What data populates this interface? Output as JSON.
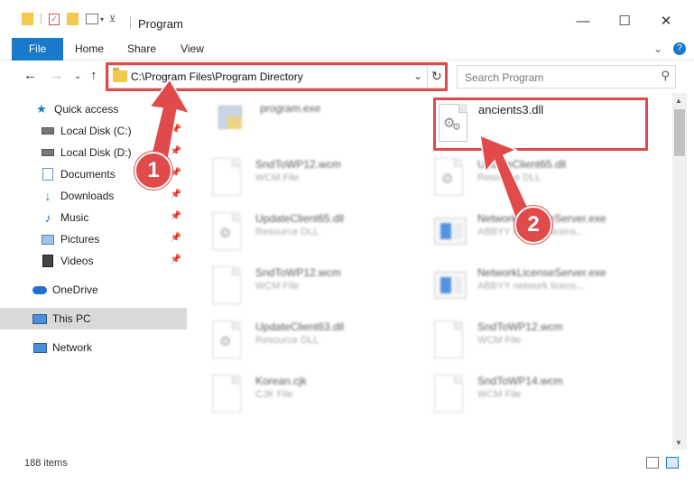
{
  "window": {
    "title": "Program",
    "minimize": "—",
    "maximize": "☐",
    "close": "✕"
  },
  "ribbon": {
    "tabs": [
      "File",
      "Home",
      "Share",
      "View"
    ],
    "collapse": "⌄",
    "help": "?"
  },
  "nav": {
    "back": "←",
    "forward": "→",
    "recent": "⌄",
    "up": "↑",
    "address": "C:\\Program Files\\Program Directory",
    "address_dropdown": "⌄",
    "refresh": "↻",
    "search_placeholder": "Search Program",
    "search_icon": "⚲"
  },
  "sidebar": {
    "items": [
      {
        "label": "Quick access",
        "icon": "star-icon"
      },
      {
        "label": "Local Disk (C:)",
        "icon": "drive-icon",
        "pinned": true
      },
      {
        "label": "Local Disk (D:)",
        "icon": "drive-icon",
        "pinned": true
      },
      {
        "label": "Documents",
        "icon": "documents-icon",
        "pinned": true
      },
      {
        "label": "Downloads",
        "icon": "downloads-icon",
        "pinned": true
      },
      {
        "label": "Music",
        "icon": "music-icon",
        "pinned": true
      },
      {
        "label": "Pictures",
        "icon": "pictures-icon",
        "pinned": true
      },
      {
        "label": "Videos",
        "icon": "videos-icon",
        "pinned": true
      },
      {
        "label": "OneDrive",
        "icon": "cloud-icon"
      },
      {
        "label": "This PC",
        "icon": "computer-icon",
        "selected": true
      },
      {
        "label": "Network",
        "icon": "network-icon"
      }
    ]
  },
  "files": [
    {
      "name": "program.exe",
      "type": ""
    },
    {
      "name": "ancients3.dll",
      "type": ""
    },
    {
      "name": "SndToWP12.wcm",
      "type": "WCM File"
    },
    {
      "name": "UpdateClient65.dll",
      "type": "Resource DLL"
    },
    {
      "name": "UpdateClient65.dll",
      "type": "Resource DLL"
    },
    {
      "name": "NetworkLicenseServer.exe",
      "type": "ABBYY network licens..."
    },
    {
      "name": "SndToWP12.wcm",
      "type": "WCM File"
    },
    {
      "name": "NetworkLicenseServer.exe",
      "type": "ABBYY network licens..."
    },
    {
      "name": "UpdateClient63.dll",
      "type": "Resource DLL"
    },
    {
      "name": "SndToWP12.wcm",
      "type": "WCM File"
    },
    {
      "name": "Korean.cjk",
      "type": "CJK File"
    },
    {
      "name": "SndToWP14.wcm",
      "type": "WCM File"
    }
  ],
  "status": {
    "item_count": "188 items"
  },
  "callouts": {
    "one": "1",
    "two": "2"
  },
  "colors": {
    "accent": "#1979ca",
    "highlight_red": "#e04a4a",
    "selected_bg": "#d9d9d9"
  }
}
